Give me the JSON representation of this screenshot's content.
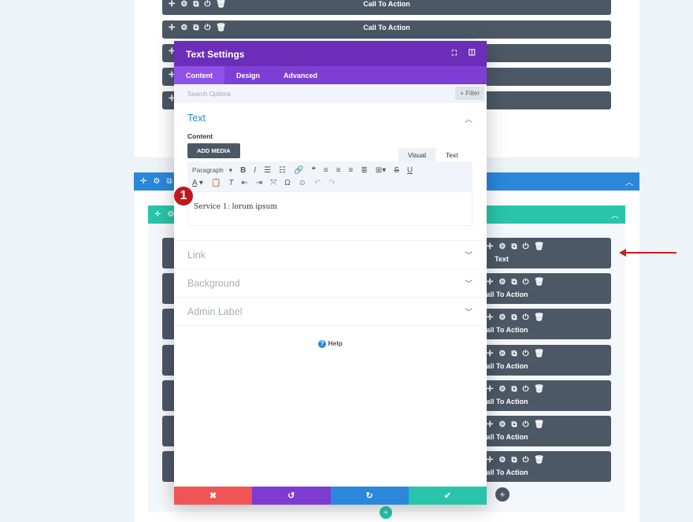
{
  "top_modules": [
    "Call To Action",
    "Call To Action",
    "",
    "",
    ""
  ],
  "lower_modules": [
    "Text",
    "Call To Action",
    "Call To Action",
    "Call To Action",
    "Call To Action",
    "Call To Action",
    "Call To Action"
  ],
  "modal": {
    "title": "Text Settings",
    "tabs": [
      "Content",
      "Design",
      "Advanced"
    ],
    "search_placeholder": "Search Options",
    "filter": "+ Filter",
    "section_text": "Text",
    "content_label": "Content",
    "add_media": "ADD MEDIA",
    "editor_tabs": [
      "Visual",
      "Text"
    ],
    "format_select": "Paragraph",
    "content": "Service 1: lorum ipsum",
    "sections": [
      "Link",
      "Background",
      "Admin Label"
    ],
    "help": "Help"
  },
  "badge": "1",
  "colors": {
    "purple": "#6c2eb9",
    "section_blue": "#2b87da",
    "row_teal": "#29c4a9",
    "module": "#4c5866",
    "cancel": "#ef5555",
    "undo": "#7e3bd0",
    "redo": "#2b87da",
    "save": "#29c4a9",
    "arrow": "#cc1f1f"
  }
}
